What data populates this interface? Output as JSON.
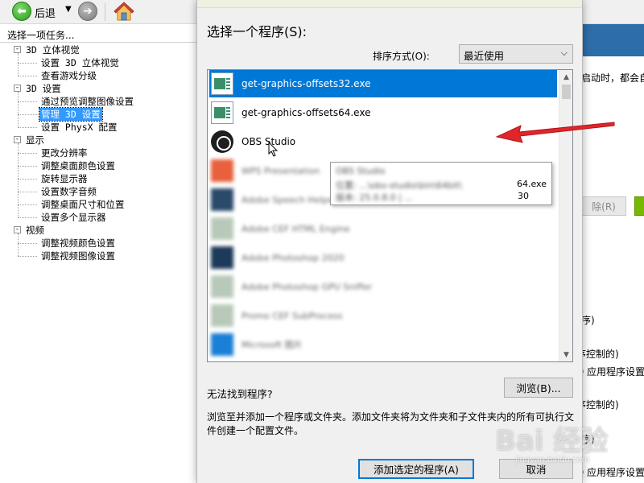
{
  "toolbar": {
    "back_label": "后退",
    "dropdown_glyph": "▼",
    "forward_glyph": "➔",
    "back_glyph": "⬅"
  },
  "tasks": {
    "title": "选择一项任务...",
    "tree": [
      {
        "label": "3D 立体视觉",
        "kind": "cat",
        "expander": "-"
      },
      {
        "label": "设置 3D 立体视觉",
        "kind": "item"
      },
      {
        "label": "查看游戏分级",
        "kind": "item"
      },
      {
        "label": "3D 设置",
        "kind": "cat",
        "expander": "-"
      },
      {
        "label": "通过预览调整图像设置",
        "kind": "item"
      },
      {
        "label": "管理 3D 设置",
        "kind": "item",
        "selected": true
      },
      {
        "label": "设置 PhysX 配置",
        "kind": "item"
      },
      {
        "label": "显示",
        "kind": "cat",
        "expander": "-"
      },
      {
        "label": "更改分辨率",
        "kind": "item"
      },
      {
        "label": "调整桌面颜色设置",
        "kind": "item"
      },
      {
        "label": "旋转显示器",
        "kind": "item"
      },
      {
        "label": "设置数字音频",
        "kind": "item"
      },
      {
        "label": "调整桌面尺寸和位置",
        "kind": "item"
      },
      {
        "label": "设置多个显示器",
        "kind": "item"
      },
      {
        "label": "视频",
        "kind": "cat",
        "expander": "-"
      },
      {
        "label": "调整视频颜色设置",
        "kind": "item"
      },
      {
        "label": "调整视频图像设置",
        "kind": "item"
      }
    ]
  },
  "background_right": {
    "line1": "启动时，都会自",
    "button": "除(R)",
    "line2": "序)",
    "line3": "序控制的)",
    "line4": "D 应用程序设置",
    "line5": "序控制的)",
    "line6": "序)",
    "line7": "D 应用程序设置"
  },
  "dialog": {
    "title": "选择一个程序(S):",
    "sort_label": "排序方式(O):",
    "sort_value": "最近使用",
    "programs": [
      {
        "label": "get-graphics-offsets32.exe",
        "icon": "exe-icon",
        "selected": true
      },
      {
        "label": "get-graphics-offsets64.exe",
        "icon": "exe-icon"
      },
      {
        "label": "OBS Studio",
        "icon": "obs-icon"
      },
      {
        "label": "WPS Presentation",
        "icon": "wps-icon",
        "blurred": true,
        "color": "#e8603c"
      },
      {
        "label": "Adobe Speech Helper",
        "icon": "adobe-icon",
        "blurred": true,
        "color": "#2a4a6a"
      },
      {
        "label": "Adobe CEF HTML Engine",
        "icon": "app-icon",
        "blurred": true,
        "color": "#b9c9b9"
      },
      {
        "label": "Adobe Photoshop 2020",
        "icon": "photoshop-icon",
        "blurred": true,
        "color": "#1e3a5a"
      },
      {
        "label": "Adobe Photoshop GPU Sniffer",
        "icon": "app-icon",
        "blurred": true,
        "color": "#b9c9b9"
      },
      {
        "label": "Promo CEF SubProcess",
        "icon": "app-icon",
        "blurred": true,
        "color": "#b9c9b9"
      },
      {
        "label": "Microsoft 图片",
        "icon": "photos-icon",
        "blurred": true,
        "color": "#1a7fd6"
      }
    ],
    "tooltip": {
      "line1": "OBS Studio",
      "line2": "位置: ...\\obs-studio\\bin\\64bit\\",
      "line3": "版本: 25.0.8.0  |  ...",
      "suffix1": "64.exe",
      "suffix2": "30"
    },
    "not_found": "无法找到程序?",
    "browse_label": "浏览(B)...",
    "hint": "浏览至并添加一个程序或文件夹。添加文件夹将为文件夹和子文件夹内的所有可执行文件创建一个配置文件。",
    "add_label": "添加选定的程序(A)",
    "cancel_label": "取消",
    "scroll_up": "▲",
    "scroll_down": "▼"
  },
  "watermark": {
    "text": "Bai 经验",
    "sub": "jingyan.baidu.com"
  },
  "colors": {
    "selection": "#0078d7",
    "tree_selection": "#3399ff",
    "arrow": "#e0262a",
    "nvidia_green": "#76b900"
  }
}
